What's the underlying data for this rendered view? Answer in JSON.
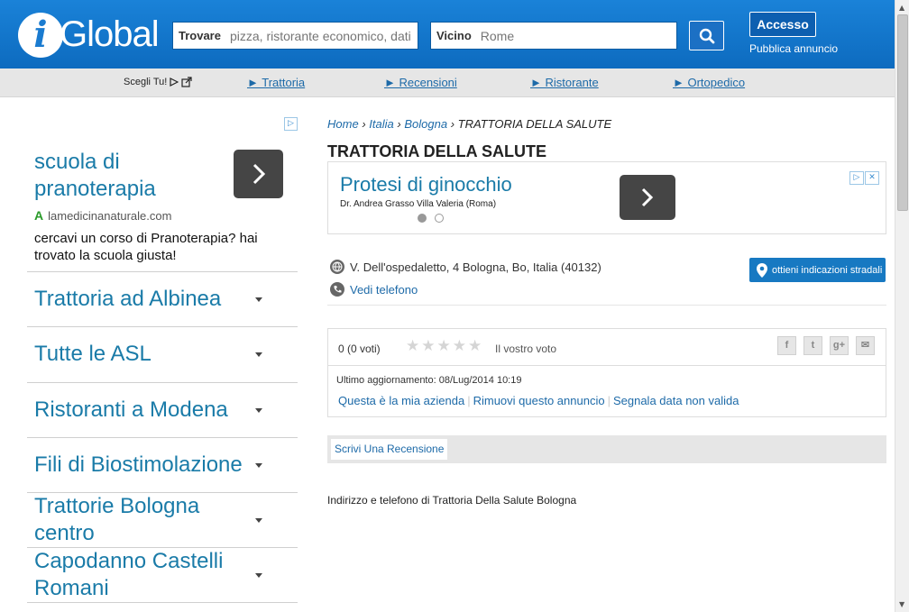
{
  "header": {
    "logo_letter": "i",
    "logo_word": "Global",
    "find_label": "Trovare",
    "find_placeholder": "pizza, ristorante economico, dati",
    "near_label": "Vicino",
    "near_placeholder": "Rome",
    "login_label": "Accesso",
    "post_ad_label": "Pubblica annuncio"
  },
  "subnav": {
    "choose_label": "Scegli Tu!",
    "links": [
      "► Trattoria",
      "► Recensioni",
      "► Ristorante",
      "► Ortopedico"
    ]
  },
  "sidebar_ad": {
    "title": "scuola di pranoterapia",
    "url": "lamedicinanaturale.com",
    "description": "cercavi un corso di Pranoterapia? hai trovato la scuola giusta!",
    "links": [
      "Trattoria ad Albinea",
      "Tutte le ASL",
      "Ristoranti a Modena",
      "Fili di Biostimolazione",
      "Trattorie Bologna centro",
      "Capodanno Castelli Romani"
    ]
  },
  "breadcrumb": {
    "home": "Home",
    "country": "Italia",
    "city": "Bologna",
    "current": "TRATTORIA DELLA SALUTE"
  },
  "page_title": "TRATTORIA DELLA SALUTE",
  "main_ad": {
    "title": "Protesi di ginocchio",
    "subtitle": "Dr. Andrea Grasso Villa Valeria (Roma)"
  },
  "listing": {
    "address": "V. Dell'ospedaletto, 4 Bologna, Bo, Italia (40132)",
    "phone_link": "Vedi telefono",
    "directions_label": "ottieni indicazioni stradali"
  },
  "rating": {
    "votes_text": "0 (0 voti)",
    "your_vote": "Il vostro voto",
    "stars_filled": 0,
    "stars_total": 5,
    "updated_text": "Ultimo aggiornamento: 08/Lug/2014 10:19",
    "owner_link": "Questa è la mia azienda",
    "remove_link": "Rimuovi questo annuncio",
    "report_link": "Segnala data non valida"
  },
  "review_button": "Scrivi Una Recensione",
  "address_description": "Indirizzo e telefono di Trattoria Della Salute Bologna",
  "colors": {
    "header_blue": "#1a82d8",
    "link_blue": "#1d6aa8",
    "ad_blue": "#1a7ba8"
  }
}
